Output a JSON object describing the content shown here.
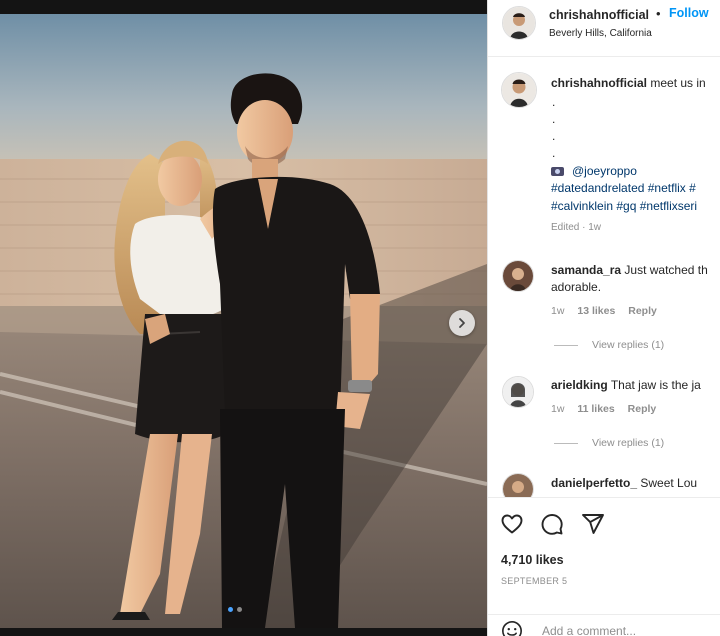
{
  "colors": {
    "accent": "#0095f6",
    "text": "#262626",
    "muted": "#8e8e8e",
    "link": "#00376b"
  },
  "photo": {
    "alt_icon": "photo",
    "carousel_count": 2,
    "carousel_index": 1,
    "next_icon": "chevron-right-icon"
  },
  "header": {
    "username": "chrishahnofficial",
    "separator": "•",
    "follow_label": "Follow",
    "location": "Beverly Hills, California"
  },
  "caption": {
    "username": "chrishahnofficial",
    "text": "meet us in",
    "bullets": [
      ".",
      ".",
      ".",
      "."
    ],
    "mention": "@joeyroppo",
    "hashtags_line1": "#datedandrelated #netflix #",
    "hashtags_line2": "#calvinklein #gq #netflixseri",
    "edited": "Edited · 1w"
  },
  "comments": [
    {
      "username": "samanda_ra",
      "text": "Just watched th",
      "text2": "adorable.",
      "age": "1w",
      "likes": "13 likes",
      "reply": "Reply",
      "view_replies": "View replies (1)"
    },
    {
      "username": "arieldking",
      "text": "That jaw is the ja",
      "age": "1w",
      "likes": "11 likes",
      "reply": "Reply",
      "view_replies": "View replies (1)"
    },
    {
      "username": "danielperfetto_",
      "text": "Sweet Lou"
    }
  ],
  "actions": {
    "likes": "4,710 likes",
    "date": "SEPTEMBER 5",
    "add_comment_placeholder": "Add a comment..."
  }
}
